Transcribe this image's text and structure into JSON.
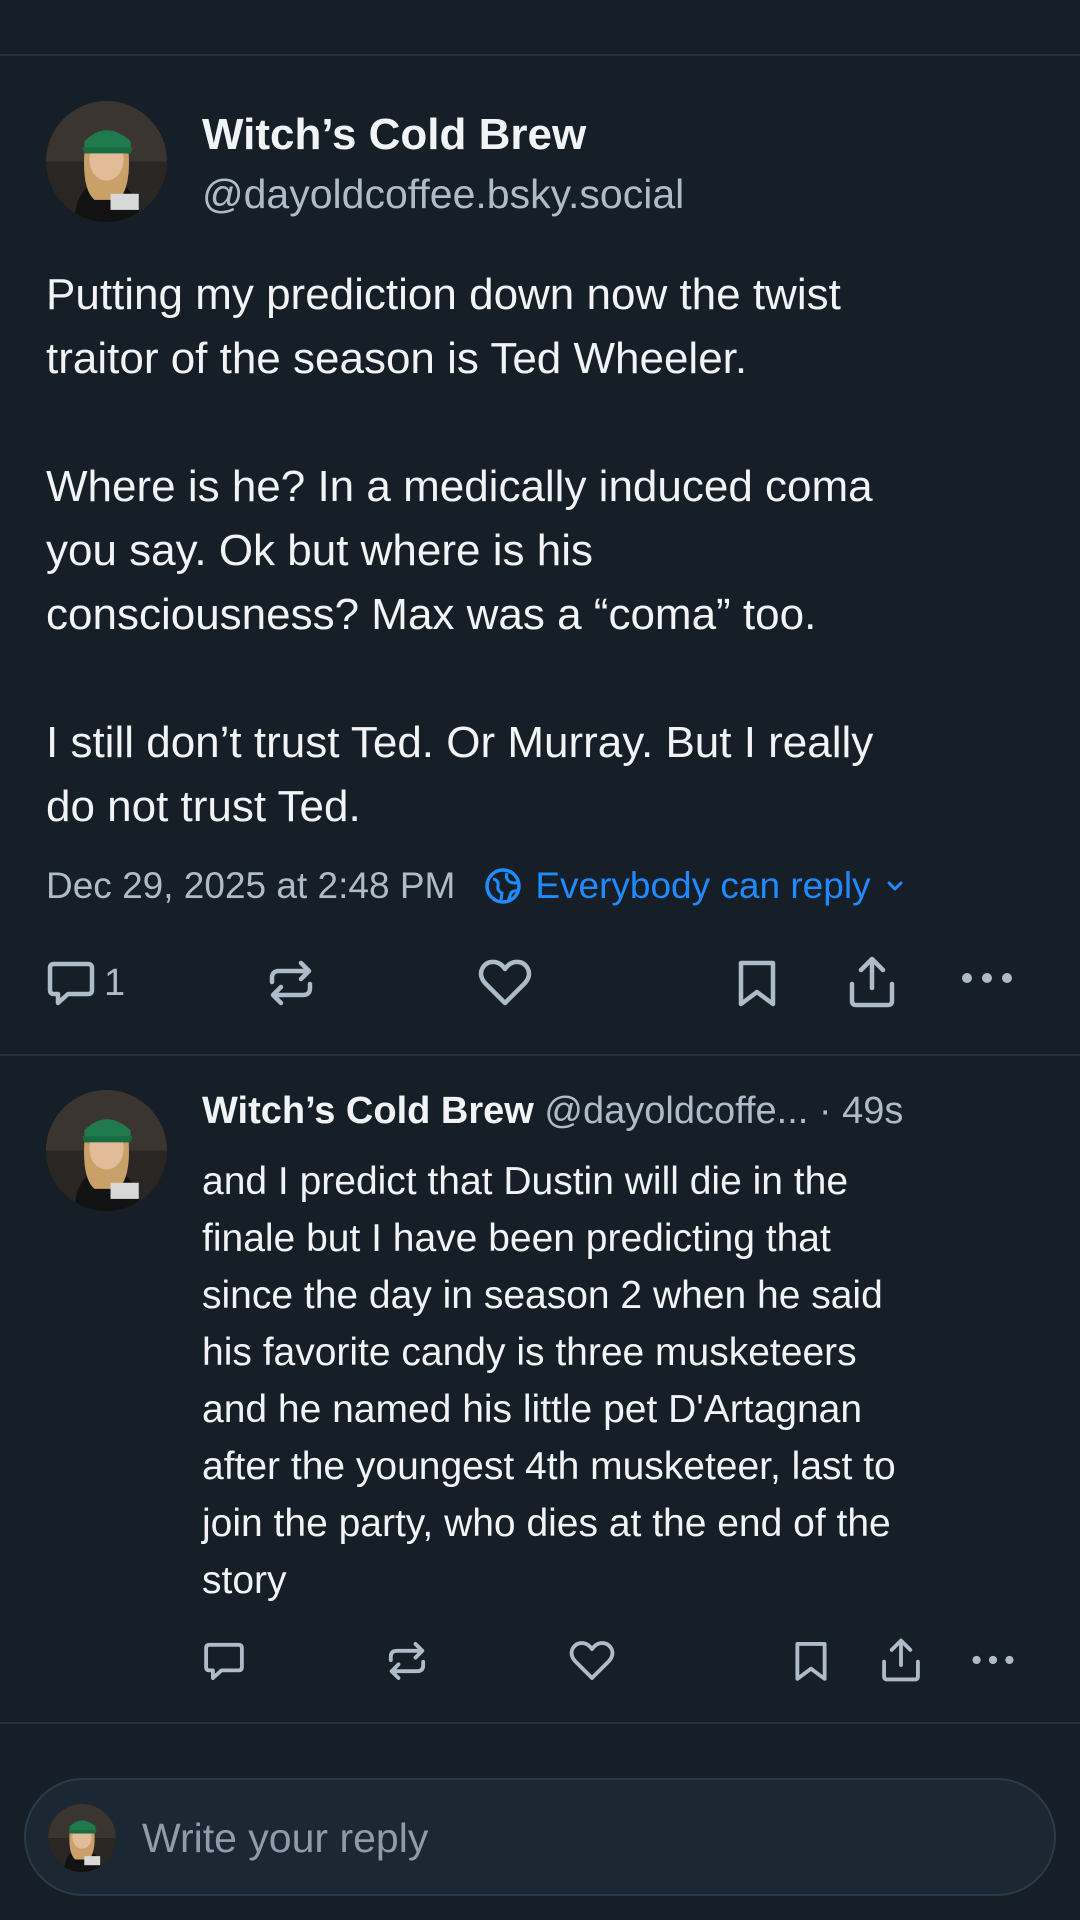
{
  "post": {
    "author_name": "Witch’s Cold Brew",
    "author_handle": "@dayoldcoffee.bsky.social",
    "text_paragraphs": [
      [
        "Putting my prediction down now the twist",
        "traitor of the season is Ted Wheeler."
      ],
      [
        "Where is he? In a medically induced coma",
        "you say. Ok but where is his",
        "consciousness? Max was a “coma” too."
      ],
      [
        "I still don’t trust Ted. Or Murray. But I really",
        "do not trust Ted."
      ]
    ],
    "timestamp": "Dec 29, 2025 at 2:48 PM",
    "reply_setting": "Everybody can reply",
    "reply_count": "1"
  },
  "reply": {
    "author_name": "Witch’s Cold Brew",
    "author_handle_truncated": "@dayoldcoffe...",
    "time_separator": " · ",
    "age": "49s",
    "text_lines": [
      "and I predict that Dustin will die in the",
      "finale but I have been predicting that",
      "since the day in season 2 when he said",
      "his favorite candy is three musketeers",
      "and he named his little pet D'Artagnan",
      "after the youngest 4th musketeer, last to",
      "join the party, who dies at the end of the",
      "story"
    ]
  },
  "composer": {
    "placeholder": "Write your reply"
  },
  "colors": {
    "background": "#161e27",
    "text": "#f1f3f5",
    "muted": "#aebbc9",
    "accent": "#208bfe",
    "divider": "#26323f"
  },
  "icons": [
    "comment-icon",
    "repost-icon",
    "like-icon",
    "bookmark-icon",
    "share-icon",
    "more-icon",
    "globe-icon",
    "chevron-down-icon"
  ]
}
